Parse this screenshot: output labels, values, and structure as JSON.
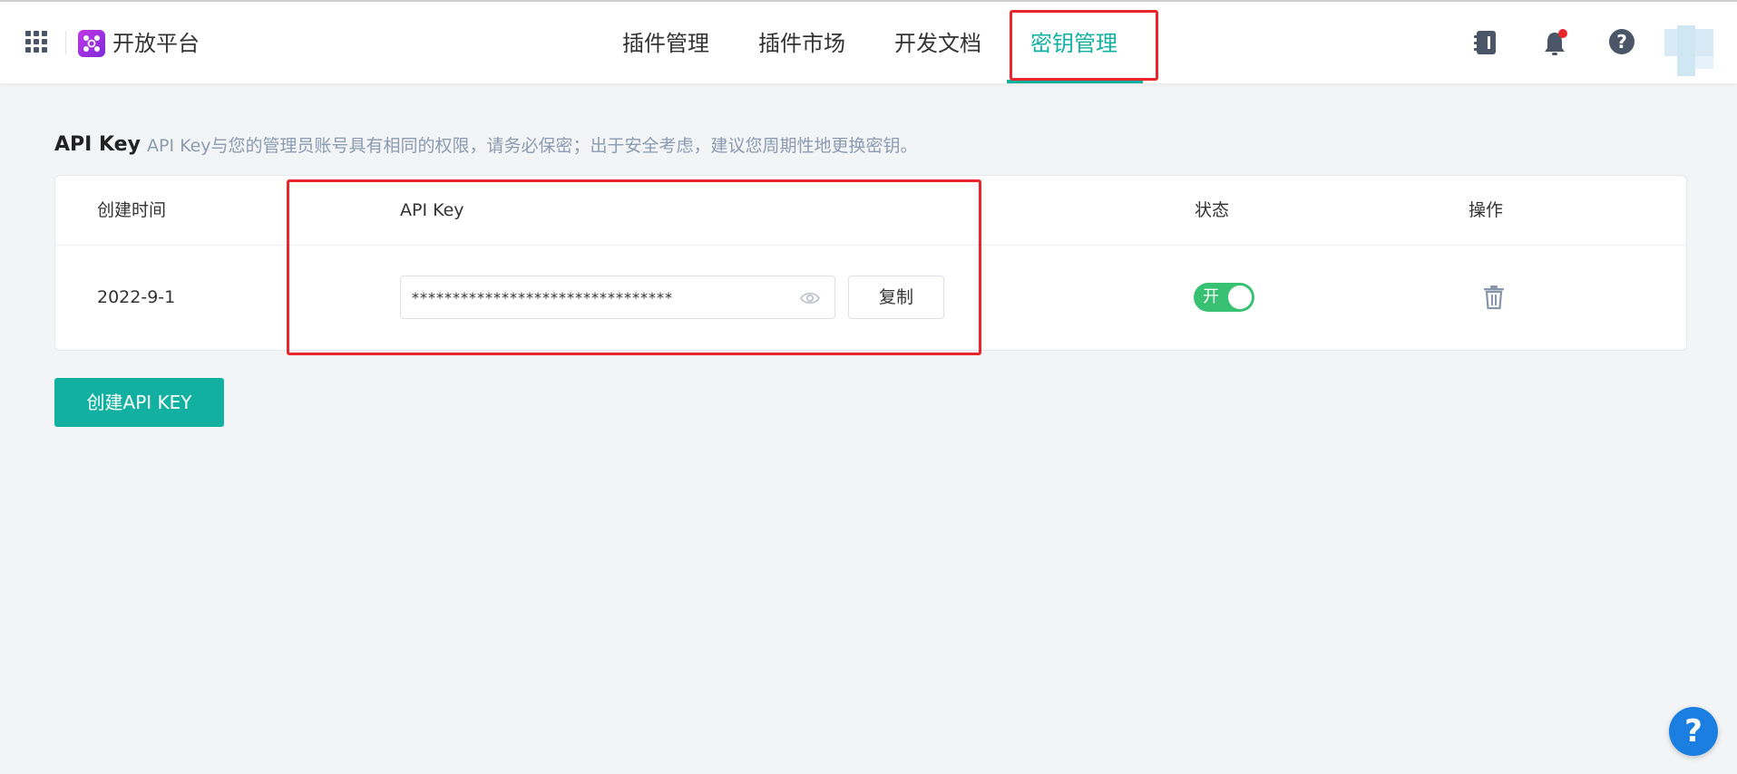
{
  "header": {
    "brand_title": "开放平台",
    "nav": [
      {
        "label": "插件管理",
        "active": false
      },
      {
        "label": "插件市场",
        "active": false
      },
      {
        "label": "开发文档",
        "active": false
      },
      {
        "label": "密钥管理",
        "active": true
      }
    ],
    "icons": [
      "apps-grid-icon",
      "notebook-icon",
      "bell-icon",
      "help-icon",
      "avatar"
    ]
  },
  "section": {
    "title": "API Key",
    "description": "API Key与您的管理员账号具有相同的权限，请务必保密；出于安全考虑，建议您周期性地更换密钥。"
  },
  "table": {
    "columns": [
      "创建时间",
      "API Key",
      "状态",
      "操作"
    ],
    "rows": [
      {
        "created": "2022-9-1",
        "api_key_masked": "********************************",
        "copy_label": "复制",
        "status_label": "开",
        "status_on": true
      }
    ]
  },
  "create_button_label": "创建API KEY",
  "float_help_label": "?",
  "header_help_label": "?",
  "colors": {
    "accent": "#12b0a0",
    "toggle_on": "#38c172",
    "highlight_box": "#e8262b",
    "float_help": "#1a7fe0"
  }
}
